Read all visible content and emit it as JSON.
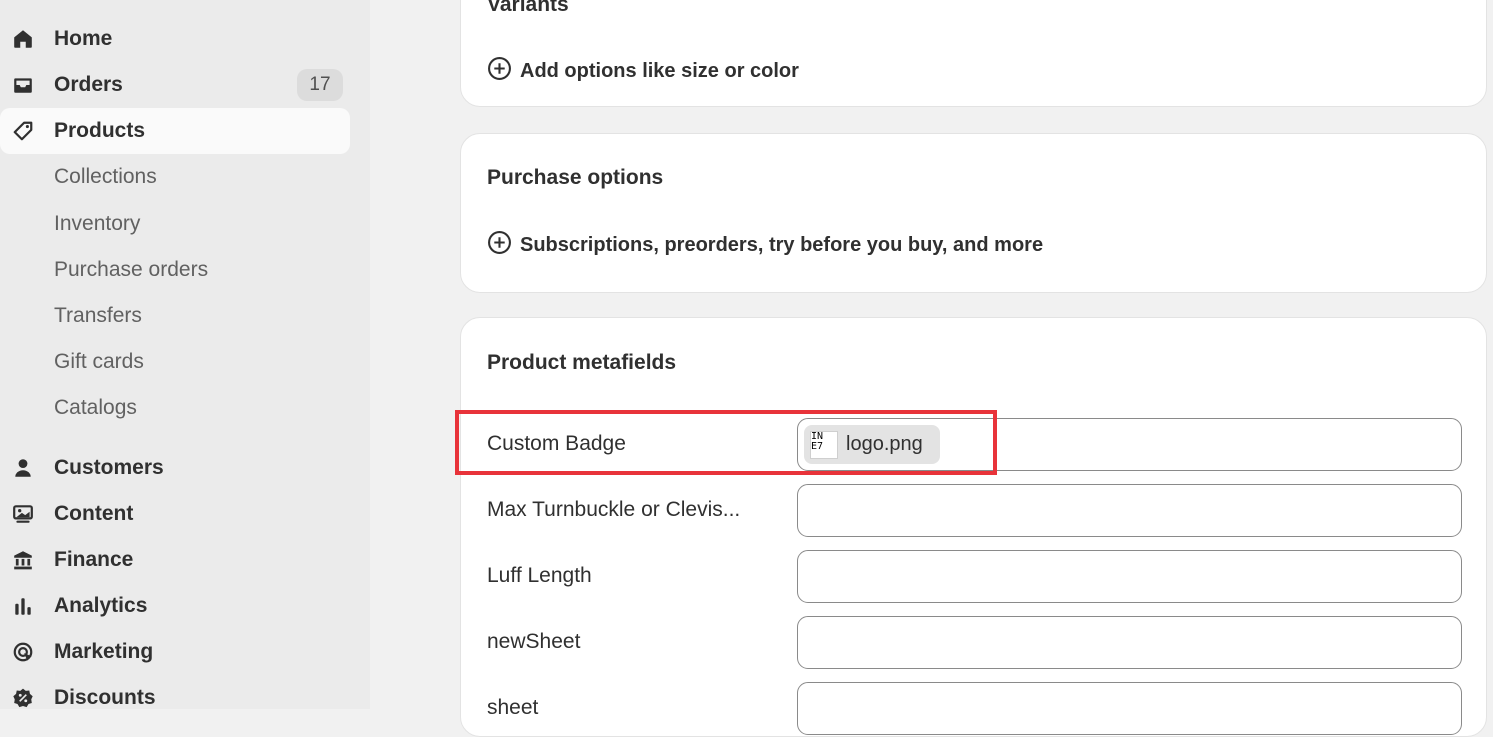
{
  "sidebar": {
    "items": [
      {
        "label": "Home",
        "icon": "home-icon"
      },
      {
        "label": "Orders",
        "icon": "inbox-icon",
        "badge": "17"
      },
      {
        "label": "Products",
        "icon": "tag-icon"
      },
      {
        "label": "Collections"
      },
      {
        "label": "Inventory"
      },
      {
        "label": "Purchase orders"
      },
      {
        "label": "Transfers"
      },
      {
        "label": "Gift cards"
      },
      {
        "label": "Catalogs"
      },
      {
        "label": "Customers",
        "icon": "person-icon"
      },
      {
        "label": "Content",
        "icon": "content-icon"
      },
      {
        "label": "Finance",
        "icon": "bank-icon"
      },
      {
        "label": "Analytics",
        "icon": "bar-chart-icon"
      },
      {
        "label": "Marketing",
        "icon": "target-icon"
      },
      {
        "label": "Discounts",
        "icon": "discount-icon"
      }
    ]
  },
  "variants": {
    "title": "Variants",
    "add_label": "Add options like size or color"
  },
  "purchase_options": {
    "title": "Purchase options",
    "add_label": "Subscriptions, preorders, try before you buy, and more"
  },
  "metafields": {
    "title": "Product metafields",
    "rows": [
      {
        "label": "Custom Badge",
        "value": "logo.png",
        "thumb_text": "IN\nE7"
      },
      {
        "label": "Max Turnbuckle or Clevis...",
        "value": ""
      },
      {
        "label": "Luff Length",
        "value": ""
      },
      {
        "label": "newSheet",
        "value": ""
      },
      {
        "label": "sheet",
        "value": ""
      }
    ]
  },
  "colors": {
    "highlight": "#e8333a",
    "sidebar_bg": "#ebebeb",
    "page_bg": "#f1f1f1"
  }
}
